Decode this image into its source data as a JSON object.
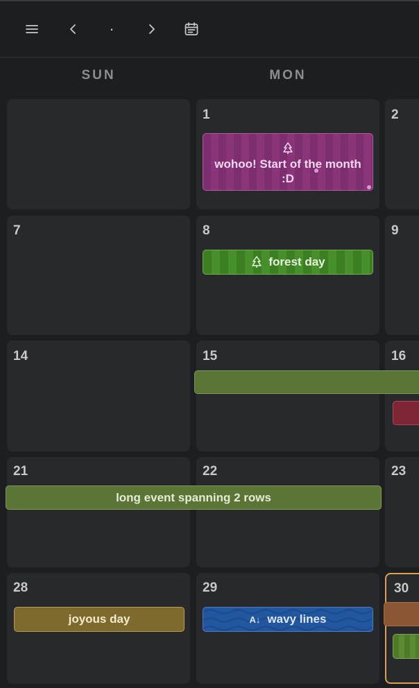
{
  "toolbar": {
    "menu_icon": "hamburger-icon",
    "prev_icon": "chevron-left-icon",
    "today_dot": "·",
    "next_icon": "chevron-right-icon",
    "calendar_icon": "calendar-icon"
  },
  "weekdays": [
    "SUN",
    "MON"
  ],
  "days": {
    "r1": [
      "",
      "1",
      "2"
    ],
    "r2": [
      "7",
      "8",
      "9"
    ],
    "r3": [
      "14",
      "15",
      "16"
    ],
    "r4": [
      "21",
      "22",
      "23"
    ],
    "r5": [
      "28",
      "29",
      "30"
    ]
  },
  "events": {
    "wohoo": {
      "icon": "tree-icon",
      "label": "wohoo! Start of the month :D"
    },
    "forest": {
      "icon": "tree-icon",
      "label": "forest day"
    },
    "long": {
      "label": "long event spanning 2 rows"
    },
    "joyous": {
      "label": "joyous day"
    },
    "wavy": {
      "icon": "sort-az-icon",
      "icon_text": "A↓",
      "label": "wavy lines"
    }
  },
  "colors": {
    "today_border": "#e0a050",
    "wohoo": "#7d2e6e",
    "forest": "#3b7f22",
    "olive": "#5a7535",
    "red": "#7e2536",
    "gold": "#7f6a2e",
    "wavy": "#22579f",
    "brown": "#8a5634"
  }
}
